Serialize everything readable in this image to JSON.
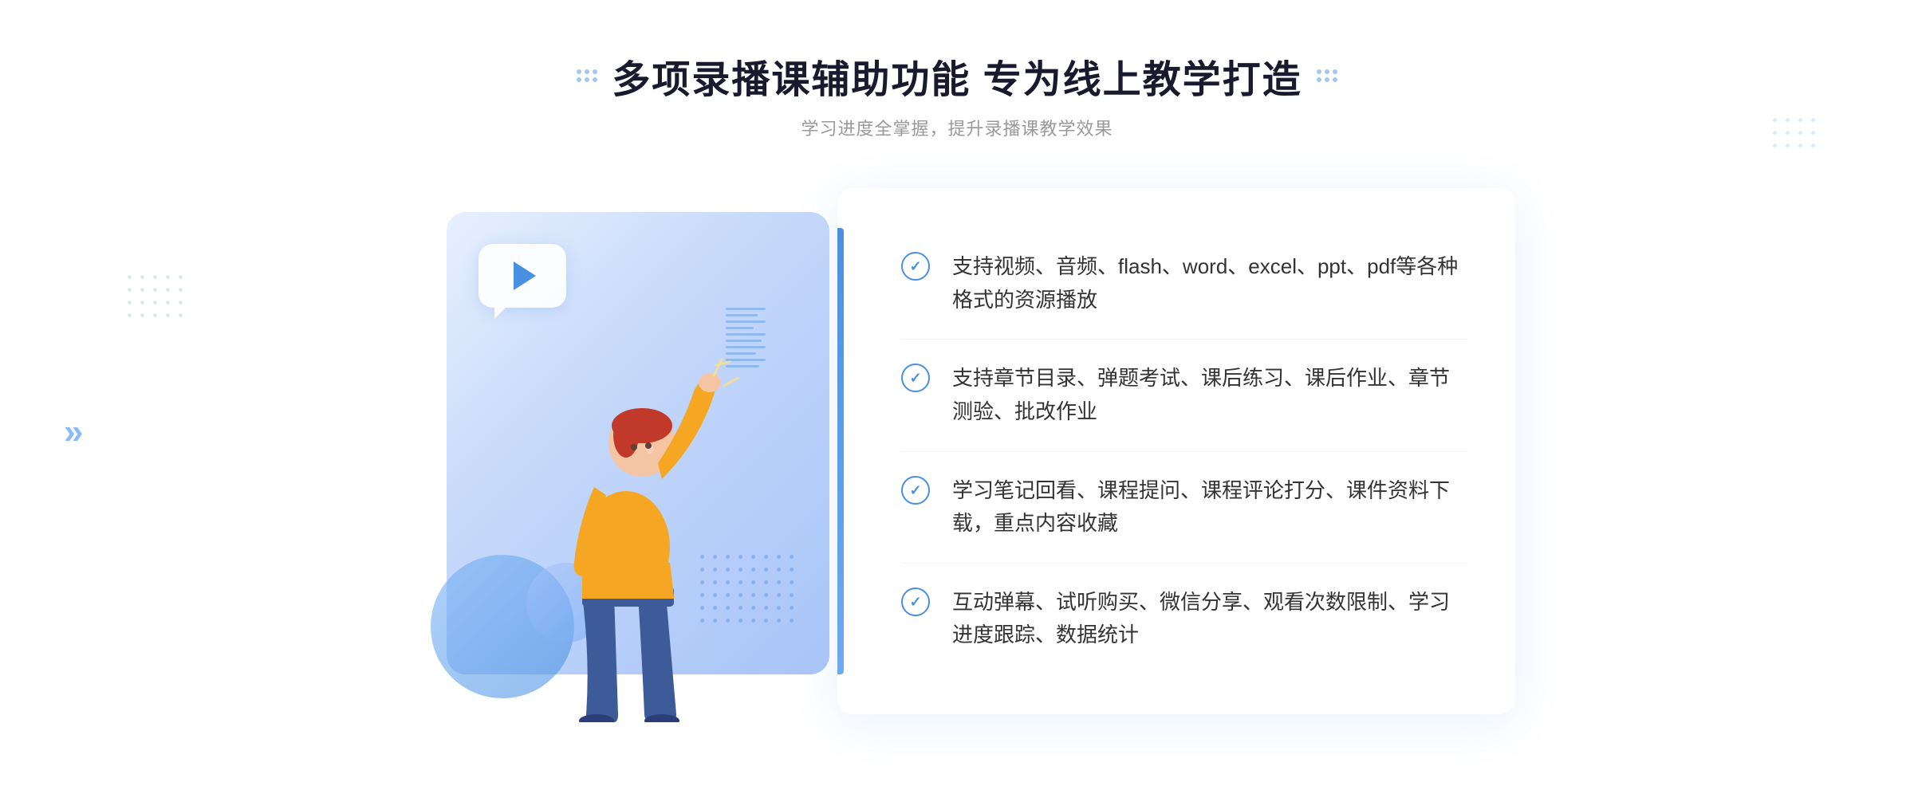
{
  "page": {
    "background": "#ffffff"
  },
  "header": {
    "title": "多项录播课辅助功能 专为线上教学打造",
    "subtitle": "学习进度全掌握，提升录播课教学效果",
    "title_dots_left": "decorative-dots-left",
    "title_dots_right": "decorative-dots-right"
  },
  "features": [
    {
      "id": 1,
      "text": "支持视频、音频、flash、word、excel、ppt、pdf等各种格式的资源播放"
    },
    {
      "id": 2,
      "text": "支持章节目录、弹题考试、课后练习、课后作业、章节测验、批改作业"
    },
    {
      "id": 3,
      "text": "学习笔记回看、课程提问、课程评论打分、课件资料下载，重点内容收藏"
    },
    {
      "id": 4,
      "text": "互动弹幕、试听购买、微信分享、观看次数限制、学习进度跟踪、数据统计"
    }
  ],
  "decoration": {
    "arrow_left": "«",
    "play_icon": "▶"
  },
  "colors": {
    "primary": "#4a90e2",
    "title": "#1a1a2e",
    "text": "#333333",
    "subtitle": "#999999",
    "panel_bg": "#ffffff",
    "illus_bg": "#ddeafc"
  }
}
